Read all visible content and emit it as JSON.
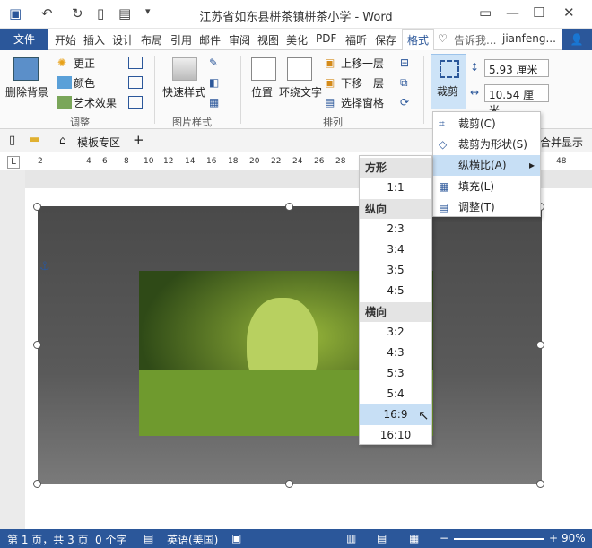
{
  "window": {
    "title": "江苏省如东县栟茶镇栟茶小学 - Word"
  },
  "tabs": [
    "文件",
    "开始",
    "插入",
    "设计",
    "布局",
    "引用",
    "邮件",
    "审阅",
    "视图",
    "美化",
    "PDF",
    "福昕",
    "保存",
    "格式"
  ],
  "tell_me": "告诉我...",
  "user": "jianfeng...",
  "ribbon": {
    "remove_bg": "删除背景",
    "correct": "更正",
    "color": "颜色",
    "artistic": "艺术效果",
    "group_adjust": "调整",
    "quick_styles": "快速样式",
    "group_pic_styles": "图片样式",
    "position": "位置",
    "wrap_text": "环绕文字",
    "bring_forward": "上移一层",
    "send_backward": "下移一层",
    "selection_pane": "选择窗格",
    "group_arrange": "排列",
    "crop": "裁剪",
    "height_val": "5.93 厘米",
    "width_val": "10.54 厘米"
  },
  "docbar": {
    "template_tab": "模板专区",
    "merge_show": "合并显示"
  },
  "ruler_numbers": [
    "2",
    "2",
    "4",
    "6",
    "8",
    "10",
    "12",
    "14",
    "16",
    "18",
    "20",
    "22",
    "24",
    "26",
    "28",
    "48"
  ],
  "crop_menu": {
    "items": [
      "裁剪(C)",
      "裁剪为形状(S)",
      "纵横比(A)",
      "填充(L)",
      "调整(T)"
    ]
  },
  "aspect_menu": {
    "square_header": "方形",
    "square": [
      "1:1"
    ],
    "portrait_header": "纵向",
    "portrait": [
      "2:3",
      "3:4",
      "3:5",
      "4:5"
    ],
    "landscape_header": "横向",
    "landscape": [
      "3:2",
      "4:3",
      "5:3",
      "5:4",
      "16:9",
      "16:10"
    ]
  },
  "status": {
    "page": "第 1 页，共 3 页",
    "words": "0 个字",
    "lang": "英语(美国)",
    "zoom": "90%"
  }
}
